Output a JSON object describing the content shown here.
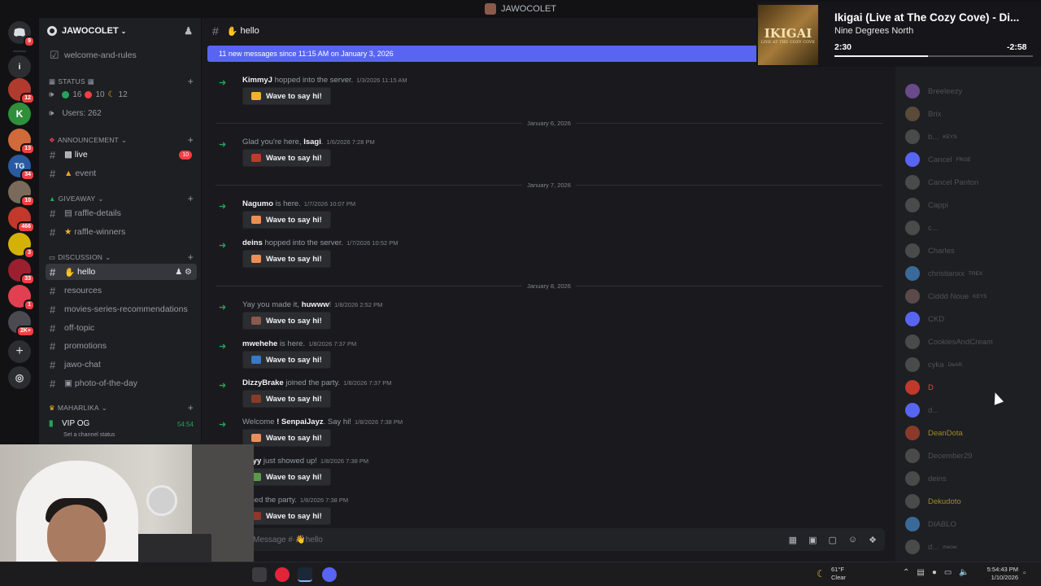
{
  "window": {
    "title": "JAWOCOLET"
  },
  "rail": {
    "badges": [
      "9",
      "12",
      "13",
      "34",
      "10",
      "466",
      "3",
      "33",
      "1",
      "2K+"
    ],
    "explore_icon": "compass-icon",
    "add_icon": "plus-icon"
  },
  "server": {
    "name": "JAWOCOLET",
    "welcome_channel": "welcome-and-rules",
    "status_category": "STATUS",
    "status_counts": {
      "online": "16",
      "dnd": "10",
      "idle": "12"
    },
    "users_label": "Users: 262",
    "categories": {
      "announcement": "ANNOUNCEMENT",
      "giveaway": "GIVEAWAY",
      "discussion": "DISCUSSION",
      "maharlika": "MAHARLIKA"
    },
    "channels": {
      "live": "live",
      "live_badge": "10",
      "event": "event",
      "raffle_details": "raffle-details",
      "raffle_winners": "raffle-winners",
      "hello": "hello",
      "resources": "resources",
      "movies": "movies-series-recommendations",
      "off_topic": "off-topic",
      "promotions": "promotions",
      "jawo_chat": "jawo-chat",
      "photo": "photo-of-the-day"
    },
    "voice": {
      "name": "VIP OG",
      "time": "54:54",
      "status": "Set a channel status"
    }
  },
  "chat": {
    "channel": "hello",
    "new_messages_bar": "11 new messages since 11:15 AM on January 3, 2026",
    "wave_label": "Wave to say hi!",
    "composer_placeholder": "Message #·👋hello",
    "dates": [
      "January 6, 2026",
      "January 7, 2026",
      "January 8, 2026"
    ],
    "messages": [
      {
        "user": "KimmyJ",
        "pre": "",
        "post": " hopped into the server.",
        "ts": "1/3/2026 11:15 AM"
      },
      {
        "user": "Isagi",
        "pre": "Glad you're here, ",
        "post": ".",
        "ts": "1/6/2026 7:28 PM"
      },
      {
        "user": "Nagumo",
        "pre": "",
        "post": " is here.",
        "ts": "1/7/2026 10:07 PM"
      },
      {
        "user": "deins",
        "pre": "",
        "post": " hopped into the server.",
        "ts": "1/7/2026 10:52 PM"
      },
      {
        "user": "huwww",
        "pre": "Yay you made it, ",
        "post": "!",
        "ts": "1/8/2026 2:52 PM"
      },
      {
        "user": "mwehehe",
        "pre": "",
        "post": " is here.",
        "ts": "1/8/2026 7:37 PM"
      },
      {
        "user": "DizzyBrake",
        "pre": "",
        "post": " joined the party.",
        "ts": "1/8/2026 7:37 PM"
      },
      {
        "user": "! SenpaiJayz",
        "pre": "Welcome ",
        "post": ". Say hi!",
        "ts": "1/8/2026 7:38 PM"
      },
      {
        "user": "wyyy",
        "pre": "",
        "post": " just showed up!",
        "ts": "1/8/2026 7:38 PM"
      },
      {
        "user": "",
        "pre": "",
        "post": "joined the party.",
        "ts": "1/8/2026 7:38 PM"
      }
    ]
  },
  "members": [
    {
      "name": "Breeleezy",
      "tag": ""
    },
    {
      "name": "Brix",
      "tag": ""
    },
    {
      "name": "b...",
      "tag": "KEYS"
    },
    {
      "name": "Cancel",
      "tag": "FRGE"
    },
    {
      "name": "Cancel Panton",
      "tag": ""
    },
    {
      "name": "Cappi",
      "tag": ""
    },
    {
      "name": "c...",
      "tag": ""
    },
    {
      "name": "Charles",
      "tag": ""
    },
    {
      "name": "christianxx",
      "tag": "TREX"
    },
    {
      "name": "Ciddd Noue",
      "tag": "KEYS"
    },
    {
      "name": "CKD",
      "tag": ""
    },
    {
      "name": "CookiesAndCream",
      "tag": ""
    },
    {
      "name": "cyka",
      "tag": "DeAR"
    },
    {
      "name": "D",
      "tag": ""
    },
    {
      "name": "d...",
      "tag": ""
    },
    {
      "name": "DeanDota",
      "tag": ""
    },
    {
      "name": "December29",
      "tag": ""
    },
    {
      "name": "deins",
      "tag": ""
    },
    {
      "name": "Dekudoto",
      "tag": ""
    },
    {
      "name": "DIABLO",
      "tag": ""
    },
    {
      "name": "d...",
      "tag": "meow"
    }
  ],
  "now_playing": {
    "title": "Ikigai (Live at The Cozy Cove) - Di...",
    "artist": "Nine Degrees North",
    "current": "2:30",
    "remaining": "-2:58",
    "progress": 0.47,
    "art_text": "IKIGAI",
    "art_sub": "LIVE AT THE COZY COVE"
  },
  "taskbar": {
    "temp": "61°F",
    "condition": "Clear",
    "time": "5:54:43 PM",
    "date": "1/10/2026"
  },
  "colors": {
    "accent": "#5865f2",
    "online": "#23a55a",
    "alert": "#f23f42"
  }
}
